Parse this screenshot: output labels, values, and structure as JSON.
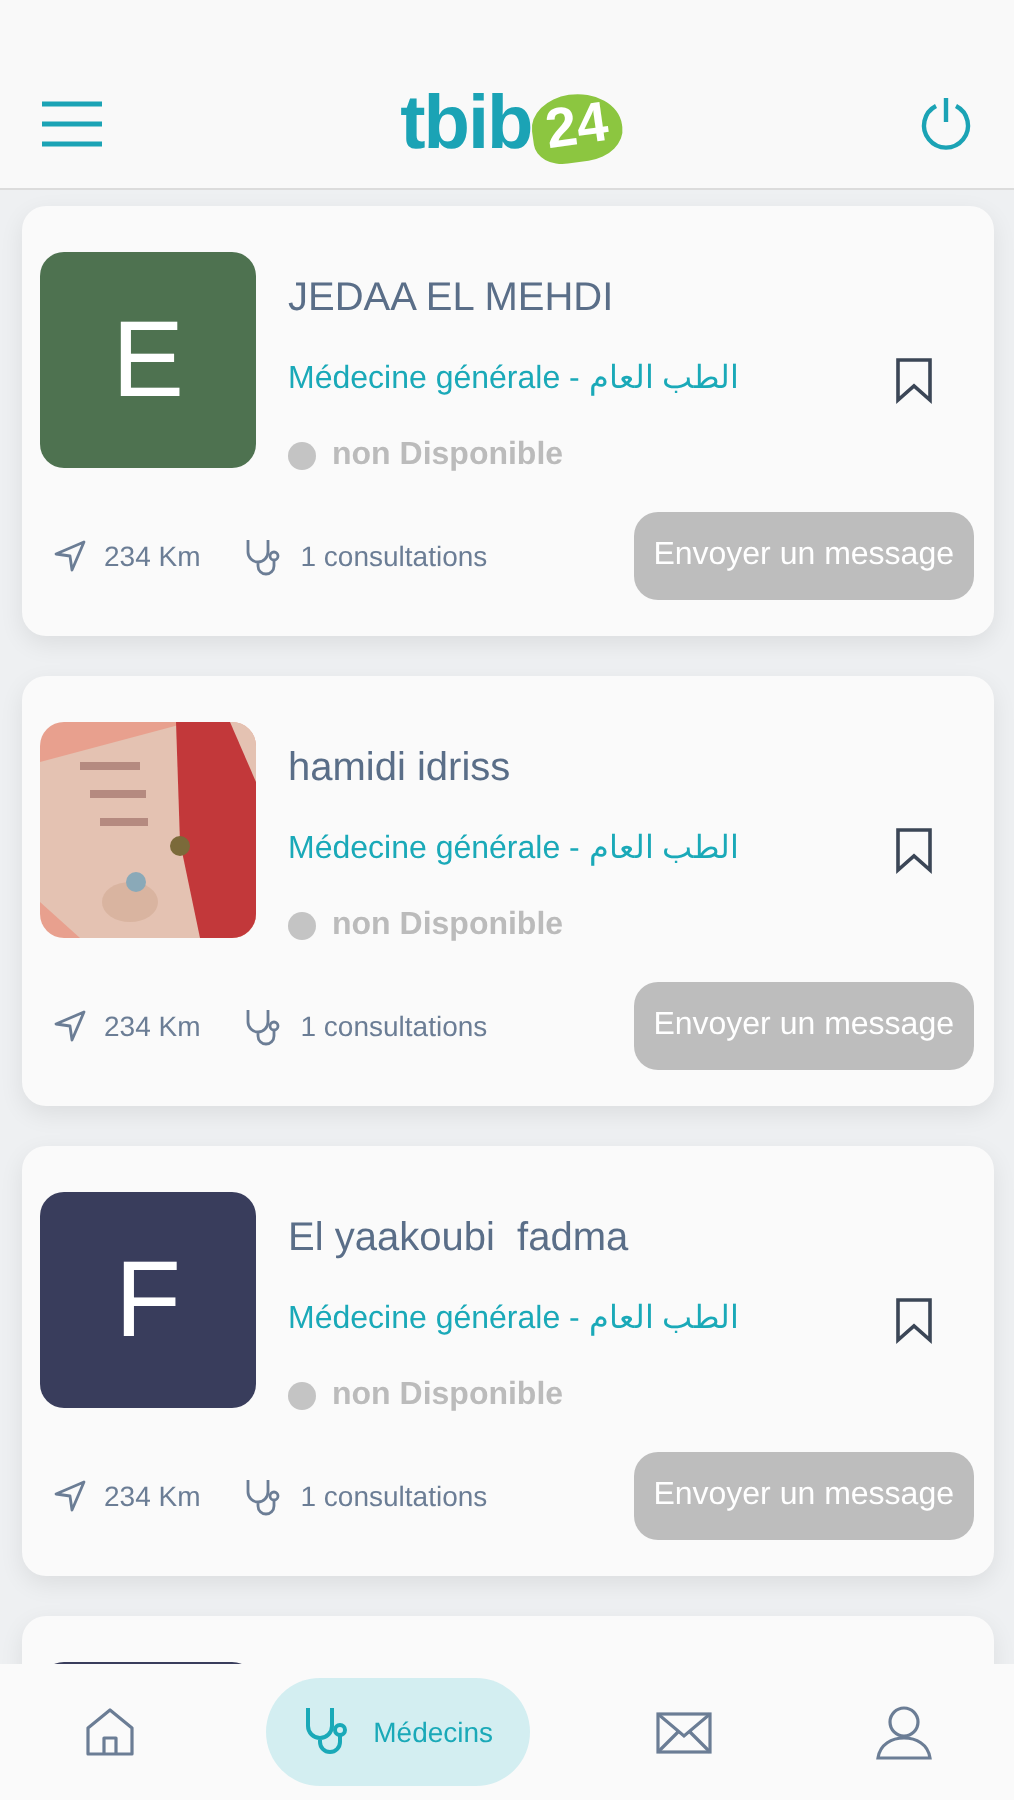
{
  "header": {
    "logo_text": "tbib",
    "logo_badge": "24"
  },
  "doctors": [
    {
      "name": "JEDAA EL MEHDI",
      "avatar": {
        "kind": "letter",
        "letter": "E",
        "color": "#4e7250"
      },
      "specialty": "Médecine générale - ",
      "specialty_ar": "الطب العام",
      "available": false,
      "status": "non Disponible",
      "bookmarked": false,
      "distance": "234 Km",
      "consultations": "1 consultations",
      "button": "Envoyer un message",
      "button_disabled": true
    },
    {
      "name": "hamidi idriss",
      "specialty": "Médecine générale - ",
      "specialty_ar": "الطب العام",
      "available": false,
      "status": "non Disponible",
      "bookmarked": false,
      "distance": "234 Km",
      "consultations": "1 consultations",
      "button": "Envoyer un message",
      "button_disabled": true
    },
    {
      "name": "El yaakoubi  fadma",
      "avatar": {
        "kind": "letter",
        "letter": "F",
        "color": "#393d5c"
      },
      "specialty": "Médecine générale - ",
      "specialty_ar": "الطب العام",
      "available": false,
      "status": "non Disponible",
      "bookmarked": false,
      "distance": "234 Km",
      "consultations": "1 consultations",
      "button": "Envoyer un message",
      "button_disabled": true
    },
    {
      "avatar": {
        "kind": "letter",
        "color": "#393d5c"
      }
    }
  ],
  "nav": [
    {
      "kind": "home",
      "selected": false
    },
    {
      "kind": "doctors",
      "label": "Médecins",
      "selected": true
    },
    {
      "kind": "mail",
      "selected": false
    },
    {
      "kind": "profile",
      "selected": false
    }
  ]
}
